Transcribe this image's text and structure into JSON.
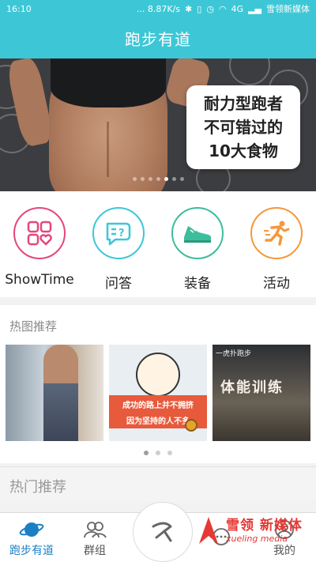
{
  "status_bar": {
    "time": "16:10",
    "speed": "... 8.87K/s",
    "network": "4G",
    "carrier": "雪领新媒体"
  },
  "header": {
    "title": "跑步有道"
  },
  "banner": {
    "headline_lines": [
      "耐力型跑者",
      "不可错过的",
      "10大食物"
    ],
    "dot_count": 7,
    "active_dot": 4
  },
  "quick_menu": [
    {
      "label": "ShowTime",
      "color": "#e4477a",
      "icon": "grid-heart-icon"
    },
    {
      "label": "问答",
      "color": "#3dc7d6",
      "icon": "chat-question-icon"
    },
    {
      "label": "装备",
      "color": "#3dbd9b",
      "icon": "sneaker-icon"
    },
    {
      "label": "活动",
      "color": "#f5983a",
      "icon": "running-man-icon"
    }
  ],
  "hot_images": {
    "title": "热图推荐",
    "thumb2_caption_line1": "成功的路上并不拥挤",
    "thumb2_caption_line2": "因为坚持的人不多",
    "thumb3_tag": "一虎扑跑步",
    "thumb3_calligraphy": "体能训练",
    "pager_count": 3,
    "pager_active": 0
  },
  "hot_recommend": {
    "title": "热门推荐"
  },
  "tab_bar": {
    "tabs": [
      {
        "label": "跑步有道",
        "icon": "planet-icon",
        "active": true
      },
      {
        "label": "群组",
        "icon": "group-icon",
        "active": false
      },
      {
        "label": "",
        "icon": "run-fab-icon",
        "active": false
      },
      {
        "label": "",
        "icon": "message-icon",
        "active": false
      },
      {
        "label": "我的",
        "icon": "profile-icon",
        "active": false
      }
    ]
  },
  "watermark": {
    "cn": "雪领 新媒体",
    "en": "xueling media"
  },
  "colors": {
    "primary": "#3dc7d6",
    "active_tab": "#1c7fc4"
  }
}
